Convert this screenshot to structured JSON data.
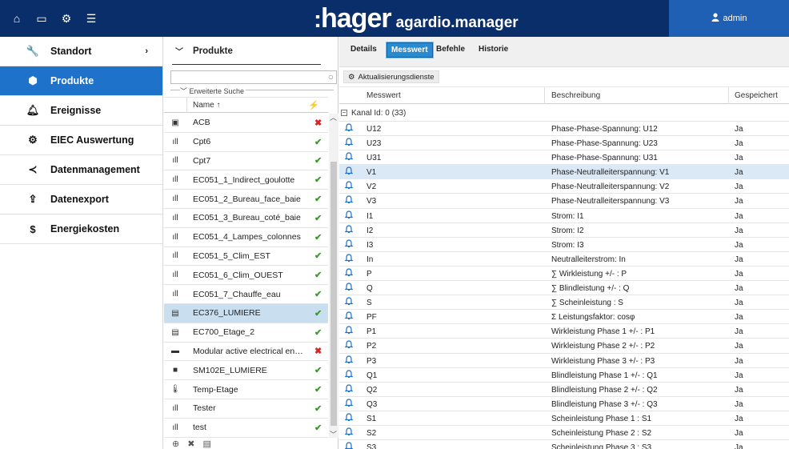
{
  "topbar": {
    "nav_icons": [
      "home-icon",
      "monitor-icon",
      "gears-icon",
      "sliders-icon"
    ],
    "brand": "hager",
    "app_name": "agardio.manager",
    "user": "admin"
  },
  "sidebar": {
    "items": [
      {
        "label": "Standort",
        "icon": "wrench-icon",
        "has_chevron": true
      },
      {
        "label": "Produkte",
        "icon": "cube-icon",
        "active": true
      },
      {
        "label": "Ereignisse",
        "icon": "bell-icon"
      },
      {
        "label": "EIEC Auswertung",
        "icon": "gears-icon"
      },
      {
        "label": "Datenmanagement",
        "icon": "share-icon"
      },
      {
        "label": "Datenexport",
        "icon": "upload-icon"
      },
      {
        "label": "Energiekosten",
        "icon": "dollar-icon"
      }
    ]
  },
  "products": {
    "title": "Produkte",
    "search_placeholder": "",
    "advanced_search": "Erweiterte Suche",
    "col_name": "Name",
    "items": [
      {
        "name": "ACB",
        "status": "error",
        "icon": "breaker-icon"
      },
      {
        "name": "Cpt6",
        "status": "ok",
        "icon": "meter-icon"
      },
      {
        "name": "Cpt7",
        "status": "ok",
        "icon": "meter-icon"
      },
      {
        "name": "EC051_1_Indirect_goulotte",
        "status": "ok",
        "icon": "meter-icon"
      },
      {
        "name": "EC051_2_Bureau_face_baie",
        "status": "ok",
        "icon": "meter-icon"
      },
      {
        "name": "EC051_3_Bureau_coté_baie",
        "status": "ok",
        "icon": "meter-icon"
      },
      {
        "name": "EC051_4_Lampes_colonnes",
        "status": "ok",
        "icon": "meter-icon"
      },
      {
        "name": "EC051_5_Clim_EST",
        "status": "ok",
        "icon": "meter-icon"
      },
      {
        "name": "EC051_6_Clim_OUEST",
        "status": "ok",
        "icon": "meter-icon"
      },
      {
        "name": "EC051_7_Chauffe_eau",
        "status": "ok",
        "icon": "meter-icon"
      },
      {
        "name": "EC376_LUMIERE",
        "status": "ok",
        "icon": "device-icon",
        "selected": true
      },
      {
        "name": "EC700_Etage_2",
        "status": "ok",
        "icon": "device-icon"
      },
      {
        "name": "Modular active electrical ener...",
        "status": "error",
        "icon": "module-icon"
      },
      {
        "name": "SM102E_LUMIERE",
        "status": "ok",
        "icon": "panel-icon"
      },
      {
        "name": "Temp-Etage",
        "status": "ok",
        "icon": "thermometer-icon"
      },
      {
        "name": "Tester",
        "status": "ok",
        "icon": "meter-icon"
      },
      {
        "name": "test",
        "status": "ok",
        "icon": "meter-icon"
      }
    ]
  },
  "main": {
    "tabs": [
      {
        "label": "Details"
      },
      {
        "label": "Messwert",
        "active": true
      },
      {
        "label": "Befehle"
      },
      {
        "label": "Historie"
      }
    ],
    "action_button": "Aktualisierungsdienste",
    "columns": {
      "measure": "Messwert",
      "desc": "Beschreibung",
      "saved": "Gespeichert"
    },
    "group_label": "Kanal Id: 0 (33)",
    "rows": [
      {
        "m": "U12",
        "d": "Phase-Phase-Spannung: U12",
        "s": "Ja"
      },
      {
        "m": "U23",
        "d": "Phase-Phase-Spannung: U23",
        "s": "Ja"
      },
      {
        "m": "U31",
        "d": "Phase-Phase-Spannung: U31",
        "s": "Ja"
      },
      {
        "m": "V1",
        "d": "Phase-Neutralleiterspannung: V1",
        "s": "Ja",
        "selected": true
      },
      {
        "m": "V2",
        "d": "Phase-Neutralleiterspannung: V2",
        "s": "Ja"
      },
      {
        "m": "V3",
        "d": "Phase-Neutralleiterspannung: V3",
        "s": "Ja"
      },
      {
        "m": "I1",
        "d": "Strom: I1",
        "s": "Ja"
      },
      {
        "m": "I2",
        "d": "Strom: I2",
        "s": "Ja"
      },
      {
        "m": "I3",
        "d": "Strom: I3",
        "s": "Ja"
      },
      {
        "m": "In",
        "d": "Neutralleiterstrom: In",
        "s": "Ja"
      },
      {
        "m": "P",
        "d": "∑ Wirkleistung +/- : P",
        "s": "Ja"
      },
      {
        "m": "Q",
        "d": "∑ Blindleistung +/- : Q",
        "s": "Ja"
      },
      {
        "m": "S",
        "d": "∑ Scheinleistung : S",
        "s": "Ja"
      },
      {
        "m": "PF",
        "d": "Σ Leistungsfaktor: cosφ",
        "s": "Ja"
      },
      {
        "m": "P1",
        "d": "Wirkleistung Phase 1 +/- : P1",
        "s": "Ja"
      },
      {
        "m": "P2",
        "d": "Wirkleistung Phase 2 +/- : P2",
        "s": "Ja"
      },
      {
        "m": "P3",
        "d": "Wirkleistung Phase 3 +/- : P3",
        "s": "Ja"
      },
      {
        "m": "Q1",
        "d": "Blindleistung Phase 1 +/- : Q1",
        "s": "Ja"
      },
      {
        "m": "Q2",
        "d": "Blindleistung Phase 2 +/- : Q2",
        "s": "Ja"
      },
      {
        "m": "Q3",
        "d": "Blindleistung Phase 3 +/- : Q3",
        "s": "Ja"
      },
      {
        "m": "S1",
        "d": "Scheinleistung Phase 1 : S1",
        "s": "Ja"
      },
      {
        "m": "S2",
        "d": "Scheinleistung Phase 2 : S2",
        "s": "Ja"
      },
      {
        "m": "S3",
        "d": "Scheinleistung Phase 3 : S3",
        "s": "Ja"
      }
    ]
  },
  "colors": {
    "topbar": "#0a2e69",
    "accent": "#1f72c9",
    "ok": "#3a9c28",
    "error": "#d92424"
  }
}
